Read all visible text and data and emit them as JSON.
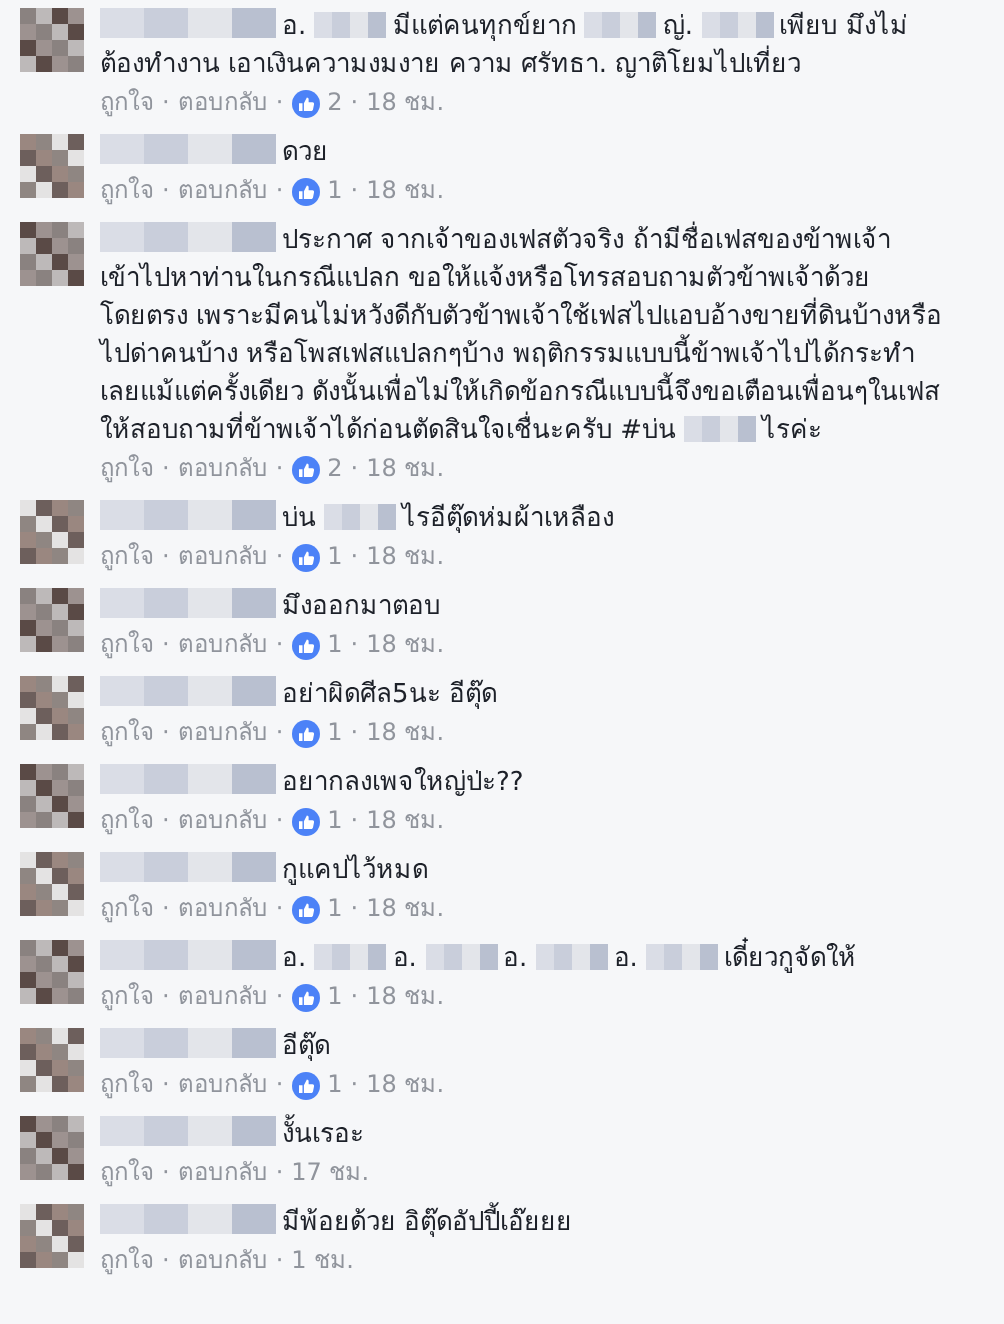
{
  "separator": "·",
  "comments": [
    {
      "parts": [
        {
          "kind": "name_redacted"
        },
        {
          "kind": "text",
          "text": "อ."
        },
        {
          "kind": "redacted"
        },
        {
          "kind": "text",
          "text": "มีแต่คนทุกข์ยาก"
        },
        {
          "kind": "redacted"
        },
        {
          "kind": "text",
          "text": "ญ่."
        },
        {
          "kind": "redacted"
        },
        {
          "kind": "text",
          "text": "เพียบ มึงไม่ต้องทำงาน เอาเงินความงมงาย ความ ศรัทธา. ญาติโยมไปเที่ยว"
        }
      ],
      "like_label": "ถูกใจ",
      "reply_label": "ตอบกลับ",
      "likes": "2",
      "time": "18 ชม."
    },
    {
      "parts": [
        {
          "kind": "name_redacted"
        },
        {
          "kind": "text",
          "text": "ดวย"
        }
      ],
      "like_label": "ถูกใจ",
      "reply_label": "ตอบกลับ",
      "likes": "1",
      "time": "18 ชม."
    },
    {
      "parts": [
        {
          "kind": "name_redacted"
        },
        {
          "kind": "text",
          "text": "ประกาศ จากเจ้าของเฟสตัวจริง ถ้ามีชื่อเฟสของข้าพเจ้าเข้าไปหาท่านในกรณีแปลก ขอให้แจ้งหรือโทรสอบถามตัวข้าพเจ้าด้วยโดยตรง เพราะมีคนไม่หวังดีกับตัวข้าพเจ้าใช้เฟสไปแอบอ้างขายที่ดินบ้างหรือไปด่าคนบ้าง หรือโพสเฟสแปลกๆบ้าง พฤติกรรมแบบนี้ข้าพเจ้าไปได้กระทำเลยแม้แต่ครั้งเดียว ดังนั้นเพื่อไม่ให้เกิดข้อกรณีแบบนี้จึงขอเตือนเพื่อนๆในเฟสให้สอบถามที่ข้าพเจ้าได้ก่อนตัดสินใจเชื่นะครับ #บ่น"
        },
        {
          "kind": "redacted"
        },
        {
          "kind": "text",
          "text": "ไรค่ะ"
        }
      ],
      "like_label": "ถูกใจ",
      "reply_label": "ตอบกลับ",
      "likes": "2",
      "time": "18 ชม."
    },
    {
      "parts": [
        {
          "kind": "name_redacted"
        },
        {
          "kind": "text",
          "text": "บ่น"
        },
        {
          "kind": "redacted"
        },
        {
          "kind": "text",
          "text": "ไรอีตุ๊ดห่มผ้าเหลือง"
        }
      ],
      "like_label": "ถูกใจ",
      "reply_label": "ตอบกลับ",
      "likes": "1",
      "time": "18 ชม."
    },
    {
      "parts": [
        {
          "kind": "name_redacted"
        },
        {
          "kind": "text",
          "text": "มึงออกมาตอบ"
        }
      ],
      "like_label": "ถูกใจ",
      "reply_label": "ตอบกลับ",
      "likes": "1",
      "time": "18 ชม."
    },
    {
      "parts": [
        {
          "kind": "name_redacted"
        },
        {
          "kind": "text",
          "text": "อย่าผิดศีล5นะ อีตุ๊ด"
        }
      ],
      "like_label": "ถูกใจ",
      "reply_label": "ตอบกลับ",
      "likes": "1",
      "time": "18 ชม."
    },
    {
      "parts": [
        {
          "kind": "name_redacted"
        },
        {
          "kind": "text",
          "text": "อยากลงเพจใหญ่ป่ะ??"
        }
      ],
      "like_label": "ถูกใจ",
      "reply_label": "ตอบกลับ",
      "likes": "1",
      "time": "18 ชม."
    },
    {
      "parts": [
        {
          "kind": "name_redacted"
        },
        {
          "kind": "text",
          "text": "กูแคปไว้หมด"
        }
      ],
      "like_label": "ถูกใจ",
      "reply_label": "ตอบกลับ",
      "likes": "1",
      "time": "18 ชม."
    },
    {
      "parts": [
        {
          "kind": "name_redacted"
        },
        {
          "kind": "text",
          "text": "อ."
        },
        {
          "kind": "redacted"
        },
        {
          "kind": "text",
          "text": "อ."
        },
        {
          "kind": "redacted"
        },
        {
          "kind": "text",
          "text": "อ."
        },
        {
          "kind": "redacted"
        },
        {
          "kind": "text",
          "text": "อ."
        },
        {
          "kind": "redacted"
        },
        {
          "kind": "text",
          "text": "เดี๋ยวกูจัดให้"
        }
      ],
      "like_label": "ถูกใจ",
      "reply_label": "ตอบกลับ",
      "likes": "1",
      "time": "18 ชม."
    },
    {
      "parts": [
        {
          "kind": "name_redacted"
        },
        {
          "kind": "text",
          "text": "อีตุ๊ด"
        }
      ],
      "like_label": "ถูกใจ",
      "reply_label": "ตอบกลับ",
      "likes": "1",
      "time": "18 ชม."
    },
    {
      "parts": [
        {
          "kind": "name_redacted"
        },
        {
          "kind": "text",
          "text": "งั้นเรอะ"
        }
      ],
      "like_label": "ถูกใจ",
      "reply_label": "ตอบกลับ",
      "time": "17 ชม."
    },
    {
      "parts": [
        {
          "kind": "name_redacted"
        },
        {
          "kind": "text",
          "text": "มีพ้อยด้วย อิตุ๊ดอัปปี้เอ๊ยยย"
        }
      ],
      "like_label": "ถูกใจ",
      "reply_label": "ตอบกลับ",
      "time": "1 ชม."
    }
  ]
}
